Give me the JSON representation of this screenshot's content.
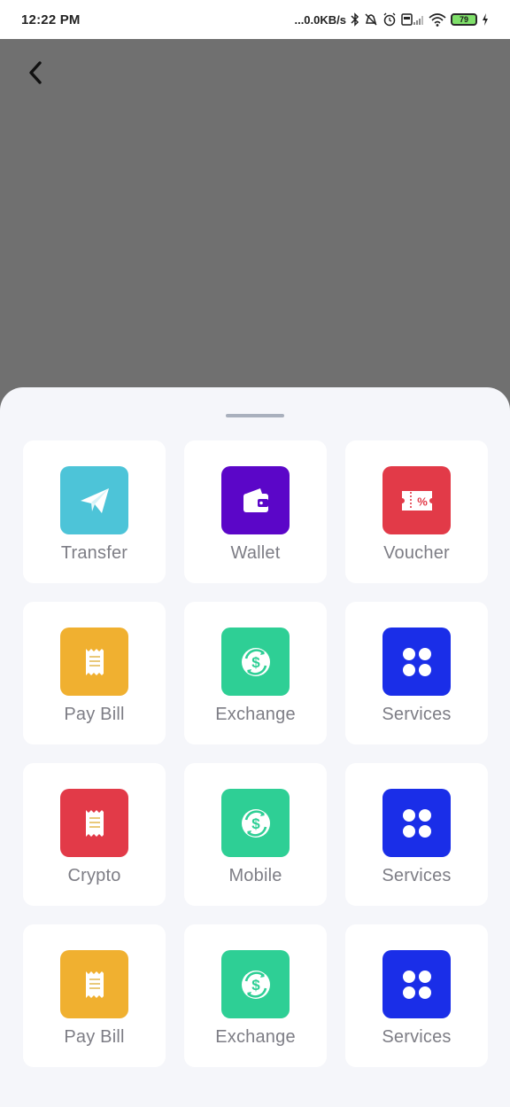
{
  "status_bar": {
    "time": "12:22 PM",
    "network_speed": "...0.0KB/s",
    "battery_level": "79"
  },
  "colors": {
    "overlay": "#707070",
    "sheet_bg": "#f5f6fa",
    "tile_bg": "#ffffff",
    "label": "#7d7d85",
    "cyan": "#4dc4d8",
    "purple": "#5b06c8",
    "red": "#e23a48",
    "amber": "#f0b030",
    "green": "#2ecf95",
    "blue": "#1a2ee8"
  },
  "tiles": [
    {
      "label": "Transfer",
      "icon": "paper-plane-icon",
      "color": "#4dc4d8"
    },
    {
      "label": "Wallet",
      "icon": "wallet-icon",
      "color": "#5b06c8"
    },
    {
      "label": "Voucher",
      "icon": "voucher-icon",
      "color": "#e23a48"
    },
    {
      "label": "Pay Bill",
      "icon": "receipt-icon",
      "color": "#f0b030"
    },
    {
      "label": "Exchange",
      "icon": "currency-exchange-icon",
      "color": "#2ecf95"
    },
    {
      "label": "Services",
      "icon": "grid-dots-icon",
      "color": "#1a2ee8"
    },
    {
      "label": "Crypto",
      "icon": "receipt-icon",
      "color": "#e23a48"
    },
    {
      "label": "Mobile",
      "icon": "currency-exchange-icon",
      "color": "#2ecf95"
    },
    {
      "label": "Services",
      "icon": "grid-dots-icon",
      "color": "#1a2ee8"
    },
    {
      "label": "Pay Bill",
      "icon": "receipt-icon",
      "color": "#f0b030"
    },
    {
      "label": "Exchange",
      "icon": "currency-exchange-icon",
      "color": "#2ecf95"
    },
    {
      "label": "Services",
      "icon": "grid-dots-icon",
      "color": "#1a2ee8"
    }
  ]
}
